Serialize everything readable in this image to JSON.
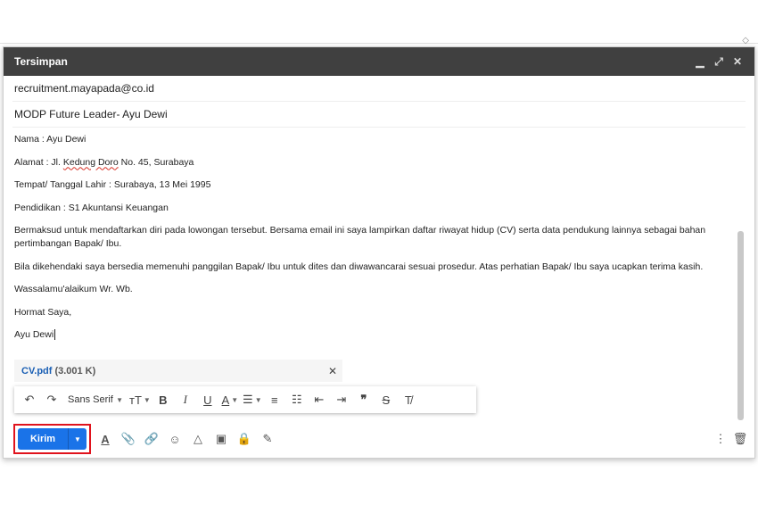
{
  "window": {
    "title": "Tersimpan",
    "controls": [
      "minimize-icon",
      "expand-icon",
      "close-icon"
    ]
  },
  "recipient": "recruitment.mayapada@co.id",
  "subject": "MODP Future Leader- Ayu Dewi",
  "body": {
    "nama": "Nama : Ayu Dewi",
    "alamat_prefix": "Alamat : Jl. ",
    "alamat_misspelled": "Kedung Doro",
    "alamat_suffix": " No. 45, Surabaya",
    "ttl": "Tempat/ Tanggal Lahir : Surabaya, 13 Mei 1995",
    "pendidikan": "Pendidikan : S1 Akuntansi Keuangan",
    "para1": "Bermaksud untuk mendaftarkan diri pada lowongan tersebut. Bersama email ini saya lampirkan daftar riwayat hidup (CV) serta data pendukung lainnya sebagai bahan pertimbangan Bapak/ Ibu.",
    "para2": "Bila dikehendaki saya bersedia memenuhi panggilan Bapak/ Ibu untuk dites dan diwawancarai sesuai prosedur. Atas perhatian Bapak/ Ibu saya ucapkan terima kasih.",
    "closing": "Wassalamu'alaikum Wr. Wb.",
    "regards": "Hormat Saya,",
    "signature": "Ayu Dewi"
  },
  "attachment": {
    "filename": "CV.pdf",
    "size": "(3.001 K)"
  },
  "formatting": {
    "font": "Sans Serif"
  },
  "send": {
    "label": "Kirim"
  },
  "colors": {
    "send_button": "#1a73e8",
    "highlight_border": "#e0131d",
    "titlebar": "#404040"
  }
}
